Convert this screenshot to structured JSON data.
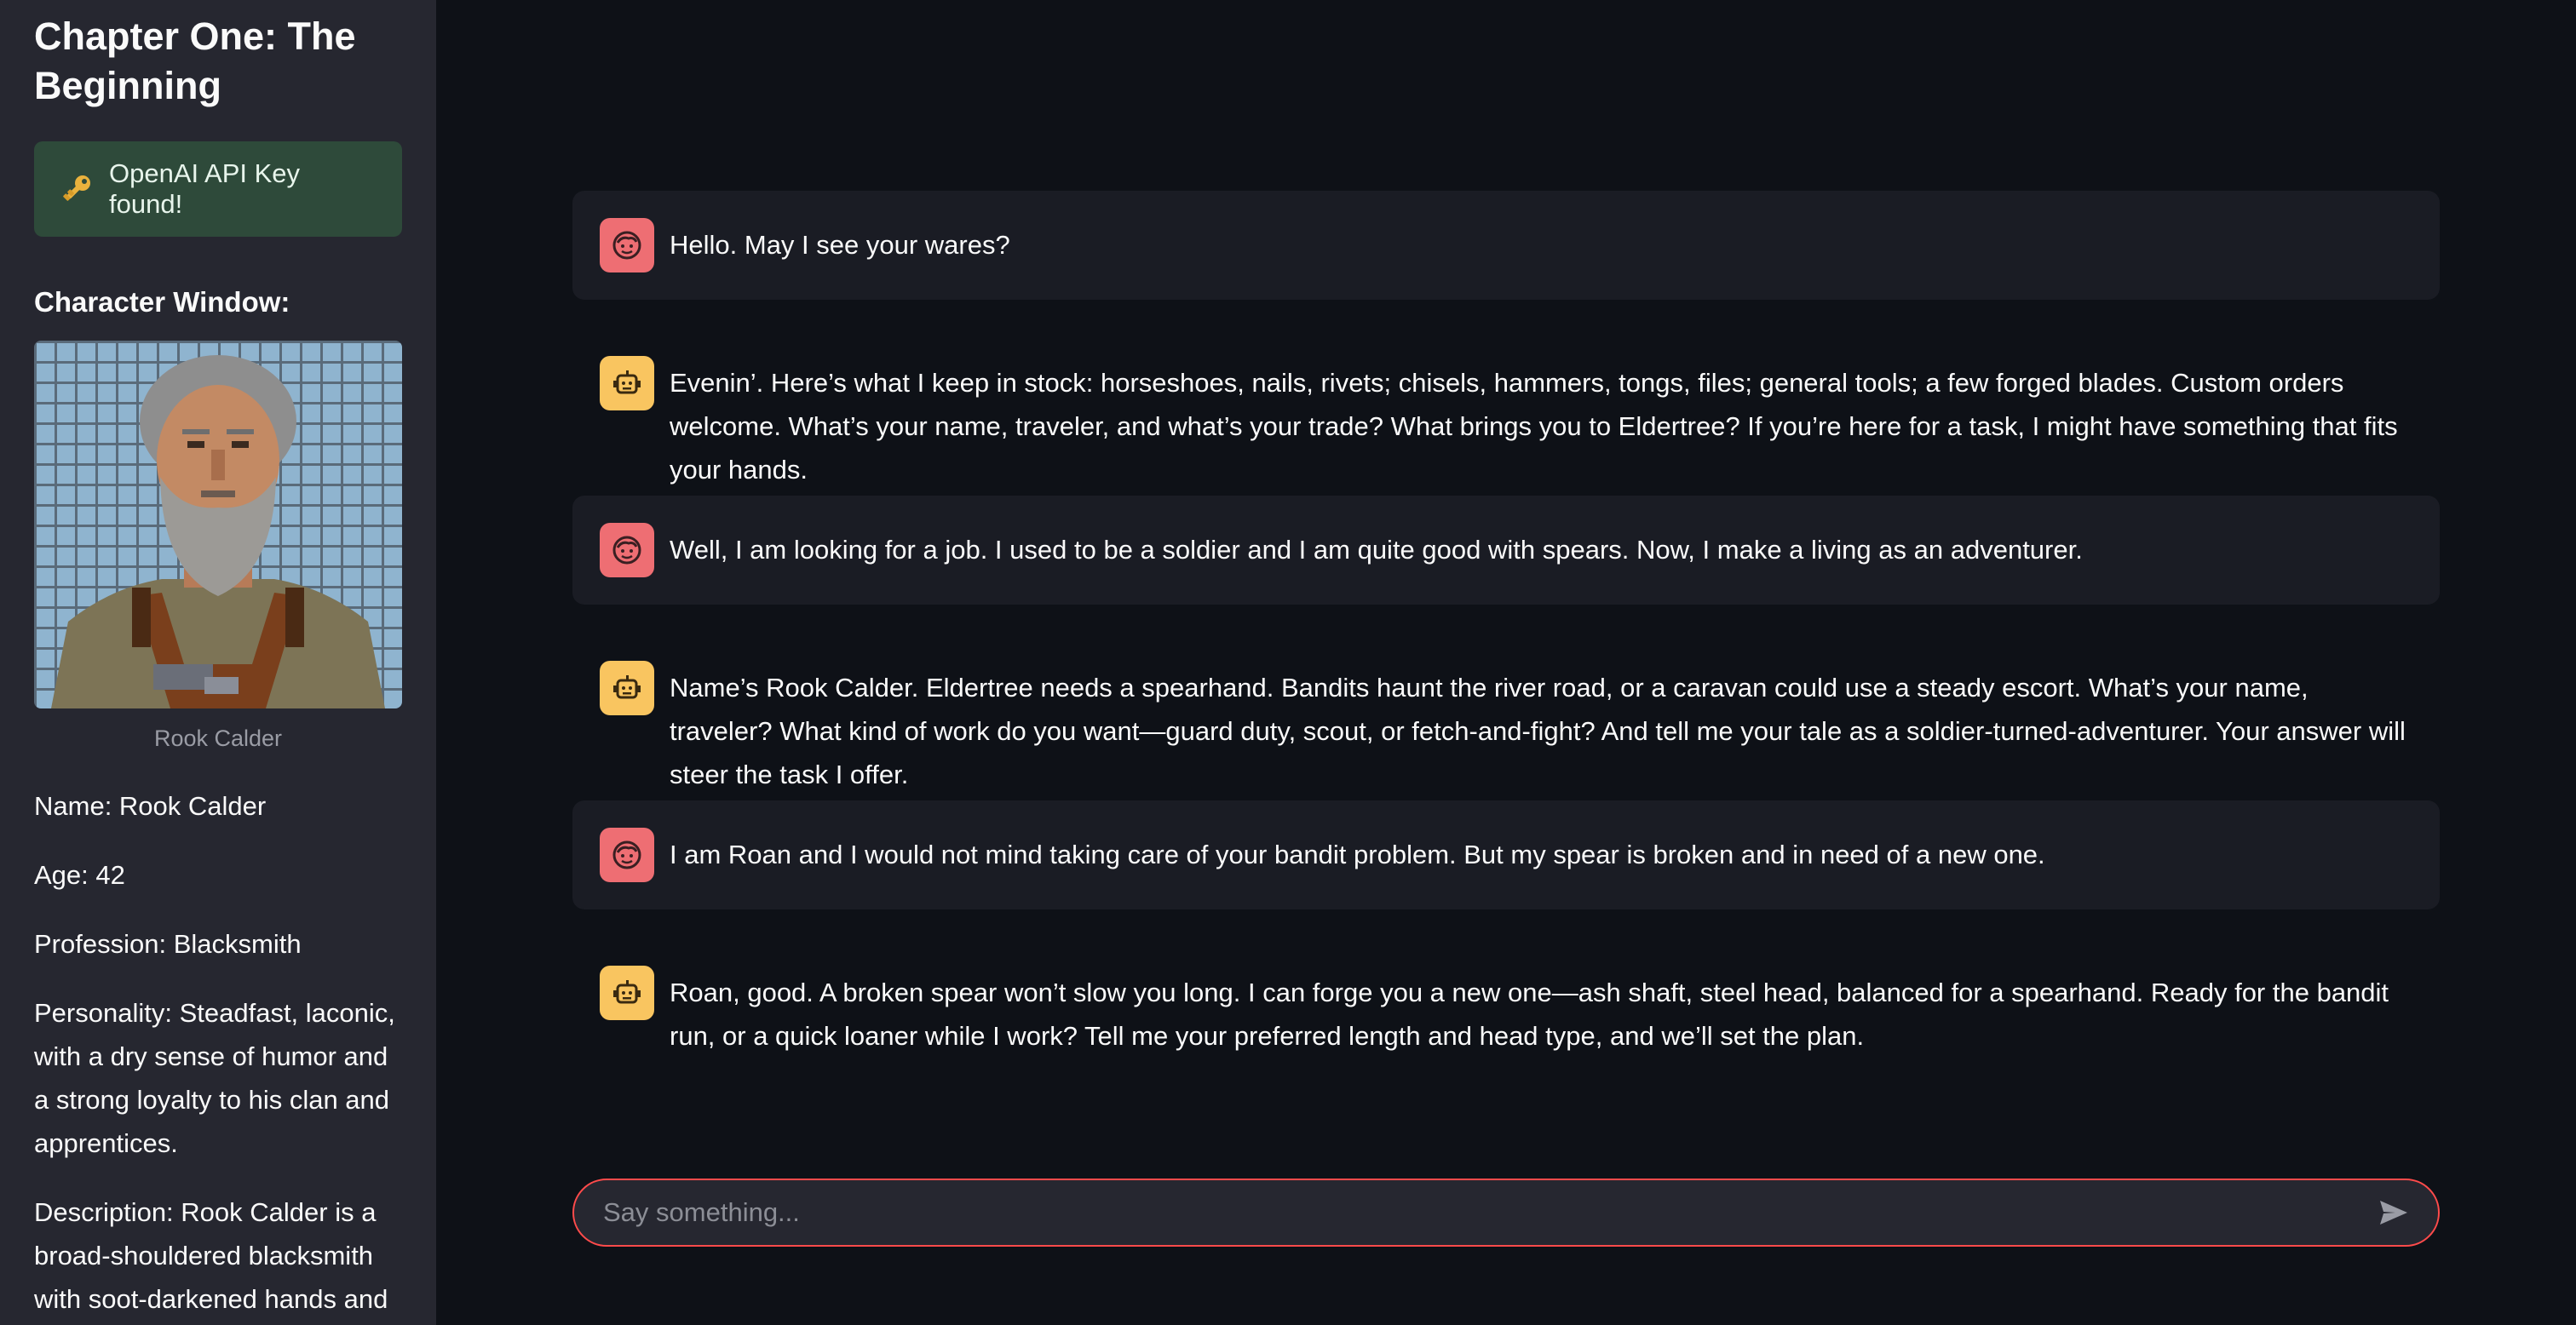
{
  "sidebar": {
    "title": "Chapter One: The Beginning",
    "api_status": {
      "icon": "key-icon",
      "text": "OpenAI API Key found!",
      "bg_color": "#2e4a3a"
    },
    "character_window_header": "Character Window:",
    "portrait_caption": "Rook Calder",
    "character": {
      "name": "Name: Rook Calder",
      "age": "Age: 42",
      "profession": "Profession: Blacksmith",
      "personality": "Personality: Steadfast, laconic, with a dry sense of humor and a strong loyalty to his clan and apprentices.",
      "description": "Description: Rook Calder is a broad-shouldered blacksmith with soot-darkened hands and a"
    }
  },
  "chat": {
    "messages": [
      {
        "role": "user",
        "avatar_icon": "user-face-icon",
        "text": "Hello. May I see your wares?"
      },
      {
        "role": "assistant",
        "avatar_icon": "robot-icon",
        "text": "Evenin’. Here’s what I keep in stock: horseshoes, nails, rivets; chisels, hammers, tongs, files; general tools; a few forged blades. Custom orders welcome. What’s your name, traveler, and what’s your trade? What brings you to Eldertree? If you’re here for a task, I might have something that fits your hands."
      },
      {
        "role": "user",
        "avatar_icon": "user-face-icon",
        "text": "Well, I am looking for a job. I used to be a soldier and I am quite good with spears. Now, I make a living as an adventurer."
      },
      {
        "role": "assistant",
        "avatar_icon": "robot-icon",
        "text": "Name’s Rook Calder. Eldertree needs a spearhand. Bandits haunt the river road, or a caravan could use a steady escort. What’s your name, traveler? What kind of work do you want—guard duty, scout, or fetch-and-fight? And tell me your tale as a soldier-turned-adventurer. Your answer will steer the task I offer."
      },
      {
        "role": "user",
        "avatar_icon": "user-face-icon",
        "text": "I am Roan and I would not mind taking care of your bandit problem. But my spear is broken and in need of a new one."
      },
      {
        "role": "assistant",
        "avatar_icon": "robot-icon",
        "text": "Roan, good. A broken spear won’t slow you long. I can forge you a new one—ash shaft, steel head, balanced for a spearhand. Ready for the bandit run, or a quick loaner while I work? Tell me your preferred length and head type, and we’ll set the plan."
      }
    ],
    "input": {
      "placeholder": "Say something...",
      "value": "",
      "border_color": "#ff4b4b",
      "send_icon": "send-icon"
    }
  },
  "colors": {
    "app_bg": "#0e1117",
    "sidebar_bg": "#262730",
    "user_avatar": "#ee6e73",
    "bot_avatar": "#f9c560"
  }
}
